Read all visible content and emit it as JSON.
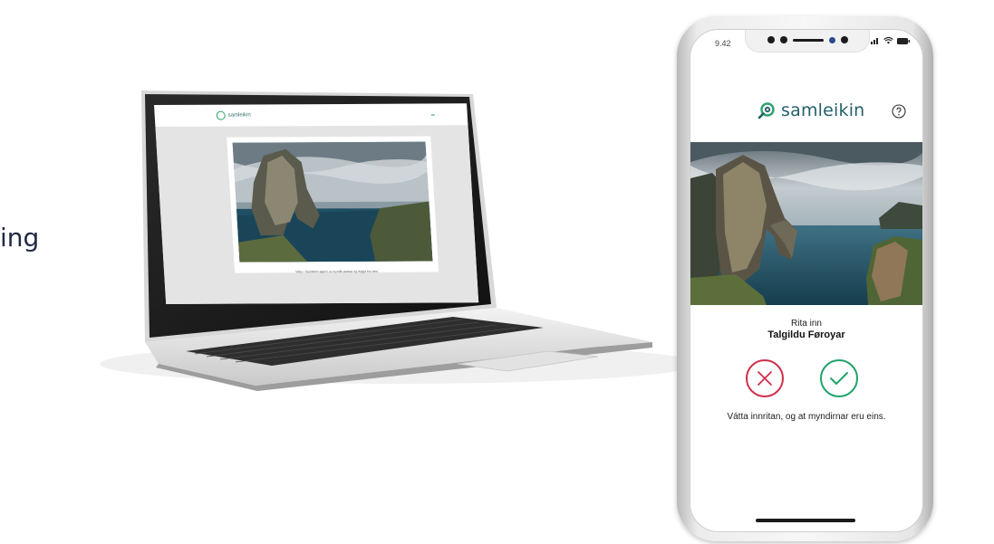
{
  "side_text": "ing",
  "laptop": {
    "logo": "samleikin",
    "nav": [
      "",
      "",
      ""
    ],
    "caption": "Váttu í Samleikin appini, at myndin passar og teygja eru eins"
  },
  "phone": {
    "status": {
      "time": "9.42"
    },
    "app": {
      "brand": "samleikin",
      "prompt_line1": "Rita inn",
      "prompt_line2": "Talgildu Føroyar",
      "instruction": "Vátta innritan, og at myndirnar eru eins."
    }
  },
  "colors": {
    "brand": "#25606a",
    "brand_accent": "#2aa36b",
    "reject": "#d12f4b",
    "confirm": "#1fa36a",
    "side_text": "#1f2a44"
  },
  "icons": [
    "samleikin-logo-icon",
    "help-icon",
    "close-icon",
    "check-icon",
    "signal-icon",
    "wifi-icon",
    "battery-icon"
  ]
}
